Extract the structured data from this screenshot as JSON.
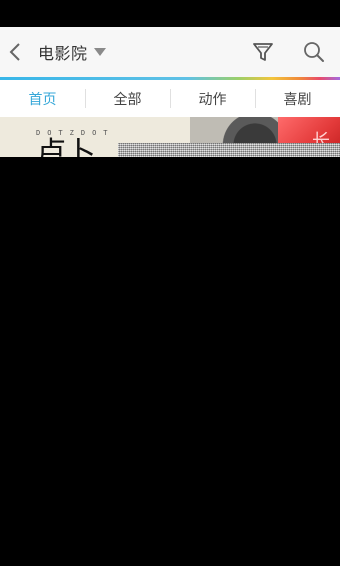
{
  "header": {
    "title": "电影院",
    "icons": {
      "back": "chevron-left-icon",
      "dropdown": "caret-down-icon",
      "filter": "filter-icon",
      "search": "search-icon"
    }
  },
  "tabs": [
    {
      "label": "首页",
      "active": true
    },
    {
      "label": "全部",
      "active": false
    },
    {
      "label": "动作",
      "active": false
    },
    {
      "label": "喜剧",
      "active": false
    }
  ],
  "banner": {
    "deco_text": "DOTZDOT",
    "big_text": "卢卜",
    "side_char": "长"
  },
  "colors": {
    "accent": "#35a7d8",
    "header_bg": "#f7f7f7",
    "tab_text": "#444444"
  }
}
